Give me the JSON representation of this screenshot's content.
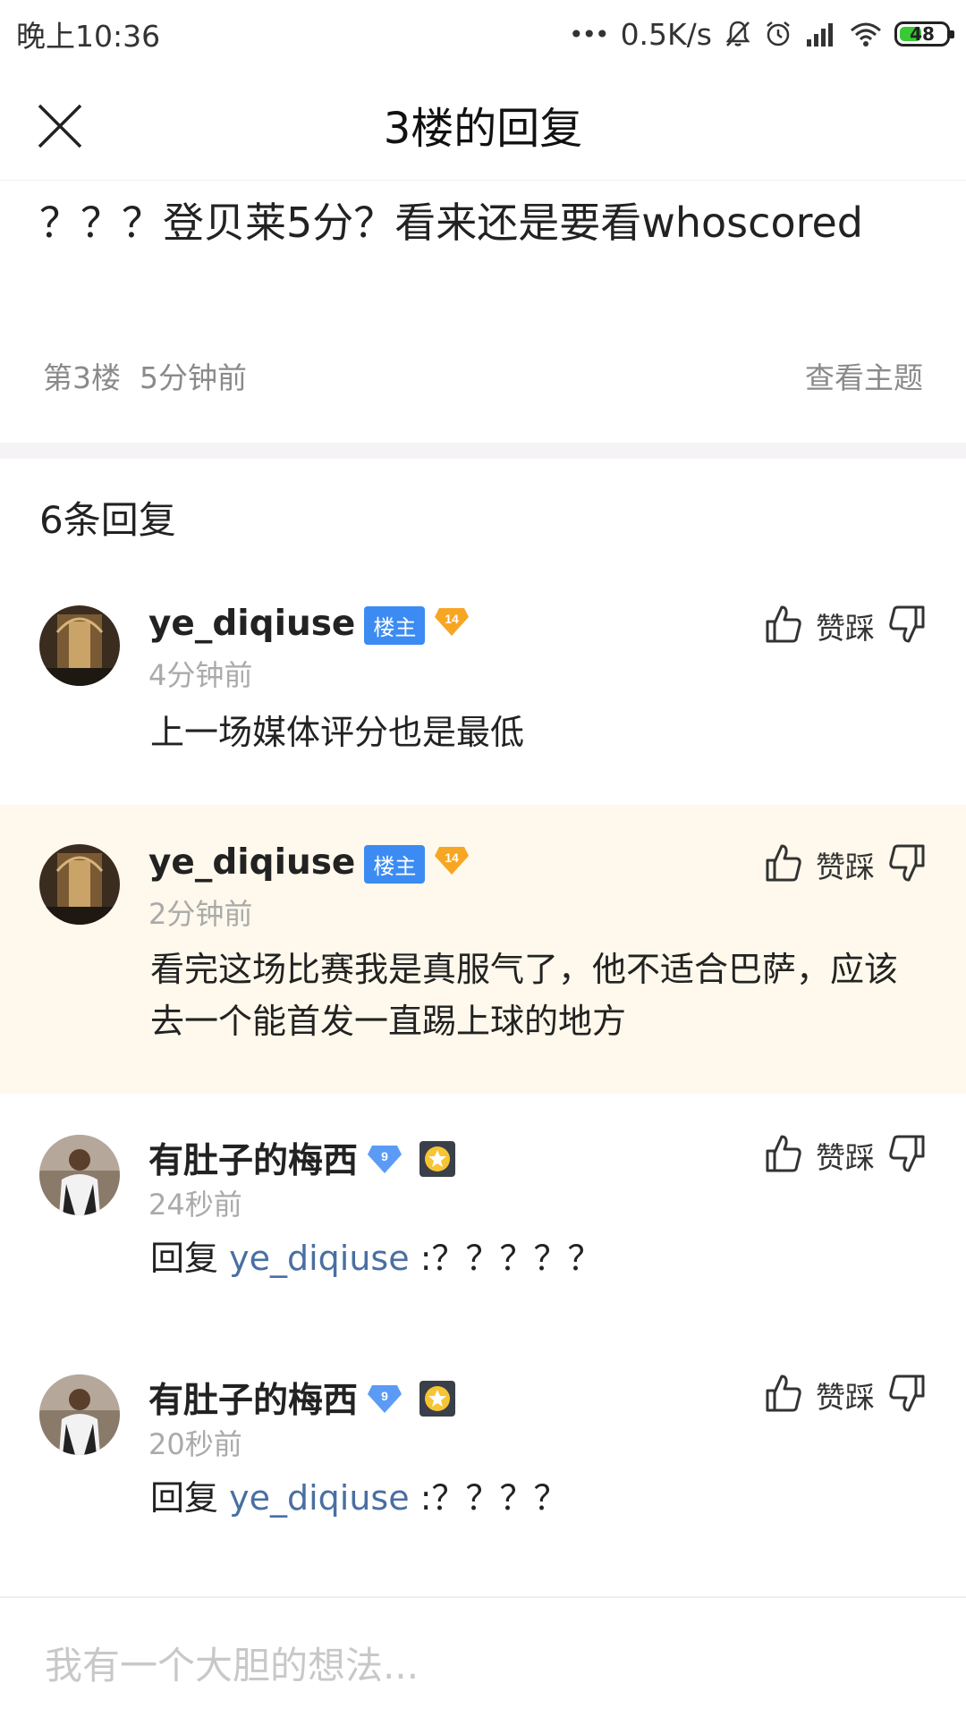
{
  "status_bar": {
    "time": "晚上10:36",
    "dots": "•••",
    "speed": "0.5K/s",
    "battery": "48",
    "battery_level_percent": 48,
    "icons": [
      "mute-bell-icon",
      "alarm-icon",
      "signal-icon",
      "wifi-icon",
      "battery-icon"
    ]
  },
  "header": {
    "title": "3楼的回复",
    "close_icon": "close-icon"
  },
  "post": {
    "text": "？？？登贝莱5分？看来还是要看whoscored",
    "floor": "第3楼",
    "time": "5分钟前",
    "view_topic": "查看主题"
  },
  "replies_header": {
    "count_label": "6条回复"
  },
  "replies": [
    {
      "username": "ye_diqiuse",
      "author_badge": "楼主",
      "level": "14",
      "time": "4分钟前",
      "text": "上一场媒体评分也是最低",
      "action_label": "赞踩",
      "highlight": false
    },
    {
      "username": "ye_diqiuse",
      "author_badge": "楼主",
      "level": "14",
      "time": "2分钟前",
      "text": "看完这场比赛我是真服气了，他不适合巴萨，应该去一个能首发一直踢上球的地方",
      "action_label": "赞踩",
      "highlight": true
    },
    {
      "username": "有肚子的梅西",
      "level": "9",
      "time": "24秒前",
      "reply_prefix": "回复",
      "mention": "ye_diqiuse",
      "text": ":？？？？？",
      "action_label": "赞踩",
      "highlight": false
    },
    {
      "username": "有肚子的梅西",
      "level": "9",
      "time": "20秒前",
      "reply_prefix": "回复",
      "mention": "ye_diqiuse",
      "text": ":？？？？",
      "action_label": "赞踩",
      "highlight": false
    }
  ],
  "input": {
    "placeholder": "我有一个大胆的想法..."
  },
  "colors": {
    "author_badge": "#3c8bf2",
    "level_badge_orange": "#f7a623",
    "level_badge_blue": "#5b9bf5",
    "highlight_bg": "#fef9ec",
    "mention": "#4a6fa1",
    "battery_fill": "#38c935"
  }
}
